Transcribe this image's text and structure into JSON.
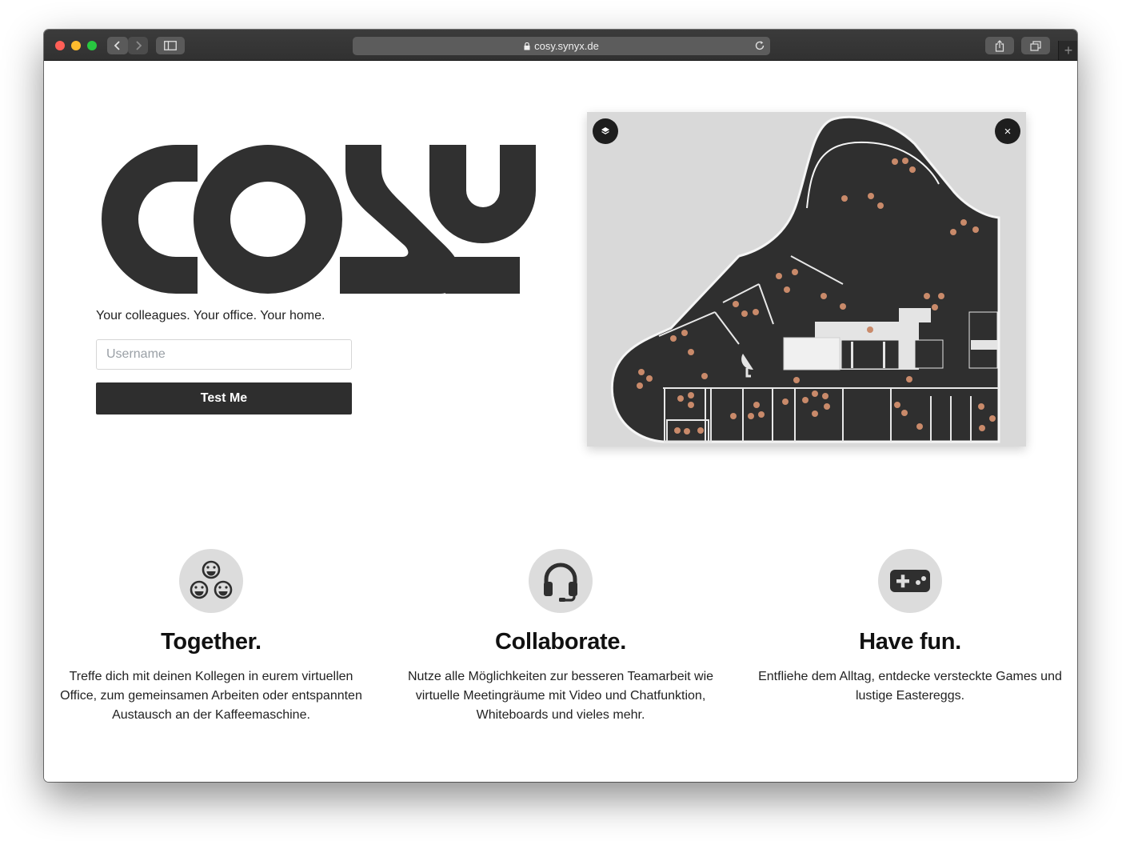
{
  "browser": {
    "url": "cosy.synyx.de"
  },
  "hero": {
    "logo_text": "cosy",
    "tagline": "Your colleagues. Your office. Your home.",
    "username_placeholder": "Username",
    "username_value": "",
    "button_label": "Test Me"
  },
  "map": {
    "layers_icon": "layers-icon",
    "close_label": "×"
  },
  "features": [
    {
      "icon": "group-faces-icon",
      "title": "Together.",
      "text": "Treffe dich mit deinen Kollegen in eurem virtuellen Office, zum gemeinsamen Arbeiten oder entspannten Austausch an der Kaffeemaschine."
    },
    {
      "icon": "headset-icon",
      "title": "Collaborate.",
      "text": "Nutze alle Möglichkeiten zur besseren Teamarbeit wie virtuelle Meetingräume mit Video und Chatfunktion, Whiteboards und vieles mehr."
    },
    {
      "icon": "gamepad-icon",
      "title": "Have fun.",
      "text": "Entfliehe dem Alltag, entdecke versteckte Games und lustige Eastereggs."
    }
  ],
  "colors": {
    "logo": "#303030",
    "button": "#2e2e2e",
    "map_floor": "#2f2f2f",
    "map_background": "#d9d9d9",
    "icon_circle": "#dcdcdc"
  }
}
